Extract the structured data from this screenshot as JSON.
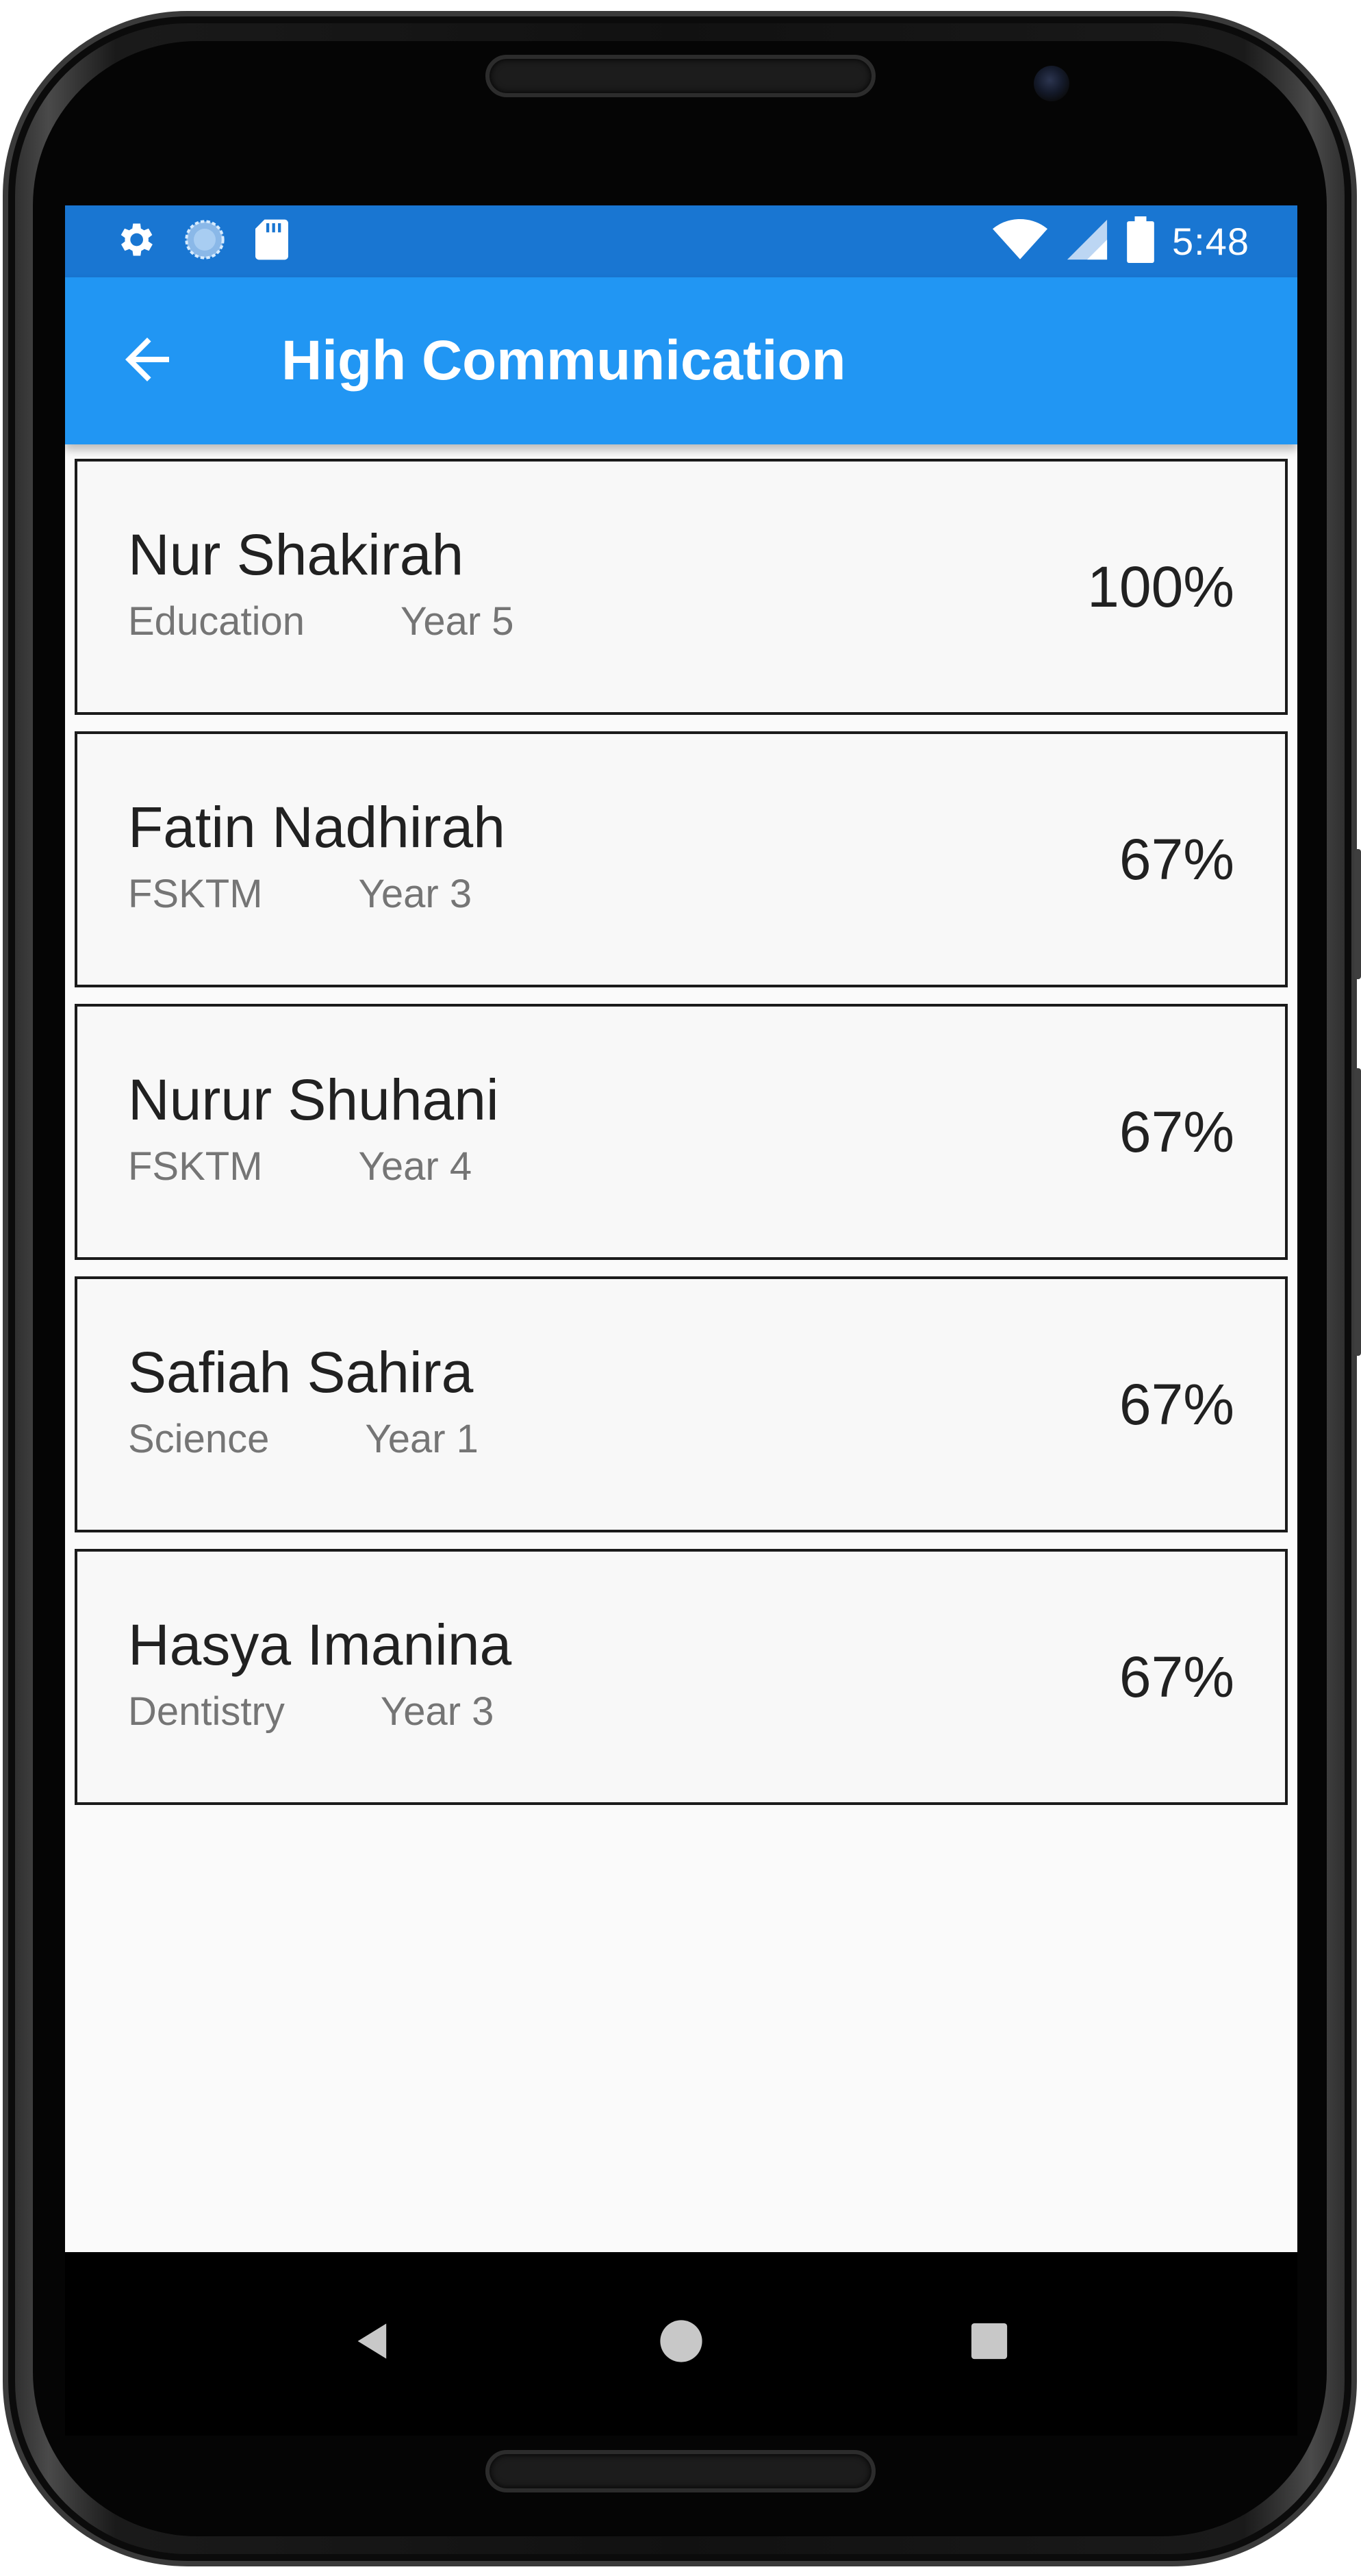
{
  "status_bar": {
    "time": "5:48",
    "left_icons": [
      "settings-icon",
      "sync-icon",
      "sd-card-icon"
    ],
    "right_icons": [
      "wifi-icon",
      "cell-signal-icon",
      "battery-icon"
    ]
  },
  "app_bar": {
    "title": "High Communication",
    "back_icon": "arrow-back-icon"
  },
  "colors": {
    "status_bar": "#1976D2",
    "app_bar": "#2196F3",
    "background": "#FAFAFA",
    "card_border": "#1b1b1b"
  },
  "students": [
    {
      "name": "Nur Shakirah",
      "faculty": "Education",
      "year": "Year 5",
      "percent": "100%"
    },
    {
      "name": "Fatin Nadhirah",
      "faculty": "FSKTM",
      "year": "Year 3",
      "percent": "67%"
    },
    {
      "name": "Nurur Shuhani",
      "faculty": "FSKTM",
      "year": "Year 4",
      "percent": "67%"
    },
    {
      "name": "Safiah Sahira",
      "faculty": "Science",
      "year": "Year 1",
      "percent": "67%"
    },
    {
      "name": "Hasya Imanina",
      "faculty": "Dentistry",
      "year": "Year 3",
      "percent": "67%"
    }
  ],
  "nav_bar": {
    "buttons": [
      "back-triangle-icon",
      "home-circle-icon",
      "recents-square-icon"
    ]
  }
}
